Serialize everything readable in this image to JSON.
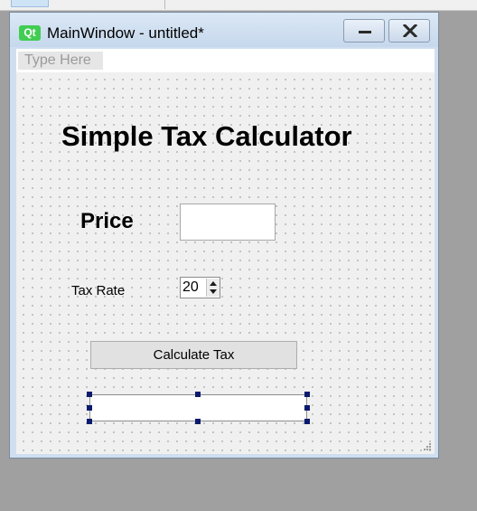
{
  "window": {
    "title": "MainWindow - untitled*",
    "logo_text": "Qt"
  },
  "menubar": {
    "placeholder": "Type Here"
  },
  "form": {
    "heading": "Simple Tax Calculator",
    "price_label": "Price",
    "price_value": "",
    "tax_rate_label": "Tax Rate",
    "tax_rate_value": "20",
    "calculate_button": "Calculate Tax",
    "result_value": ""
  },
  "colors": {
    "qt_green": "#41cd52",
    "selection_handle": "#0a1a6e",
    "desktop_background": "#a0a0a0"
  }
}
